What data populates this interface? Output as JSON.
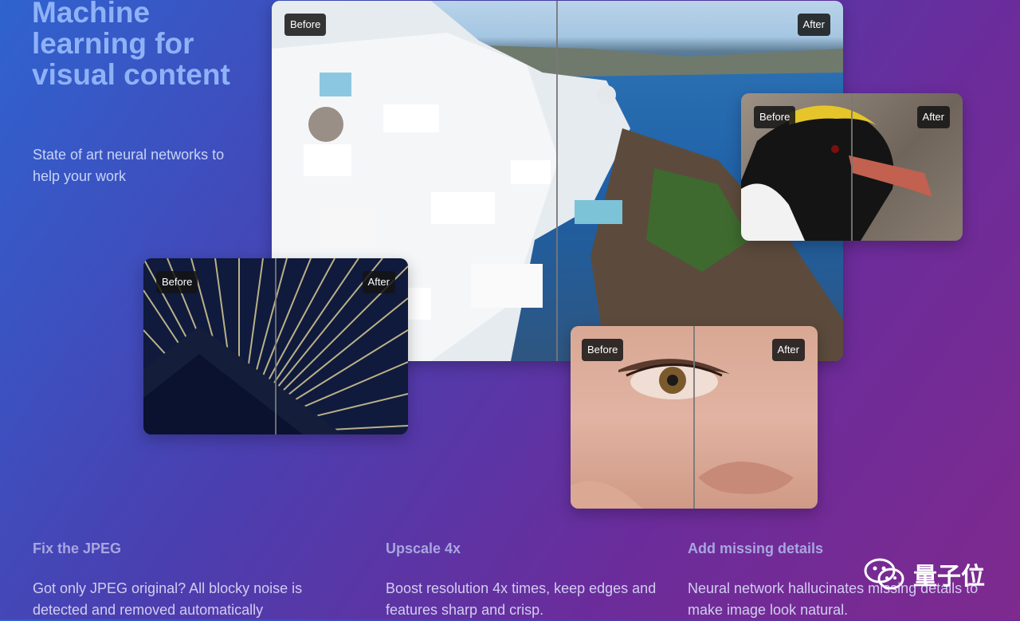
{
  "hero": {
    "title": "Machine learning for visual content",
    "subtitle": "State of art neural networks to help your work"
  },
  "labels": {
    "before": "Before",
    "after": "After"
  },
  "features": [
    {
      "title": "Fix the JPEG",
      "text": "Got only JPEG original? All blocky noise is detected and removed automatically"
    },
    {
      "title": "Upscale 4x",
      "text": "Boost resolution 4x times, keep edges and features sharp and crisp."
    },
    {
      "title": "Add missing details",
      "text": "Neural network hallucinates missing details to make image look natural."
    }
  ],
  "watermark": {
    "text": "量子位",
    "icon": "wechat-icon"
  },
  "colors": {
    "title": "#8fb2f7",
    "feature_title": "#a8a6e0",
    "tag_bg": "#141414"
  }
}
